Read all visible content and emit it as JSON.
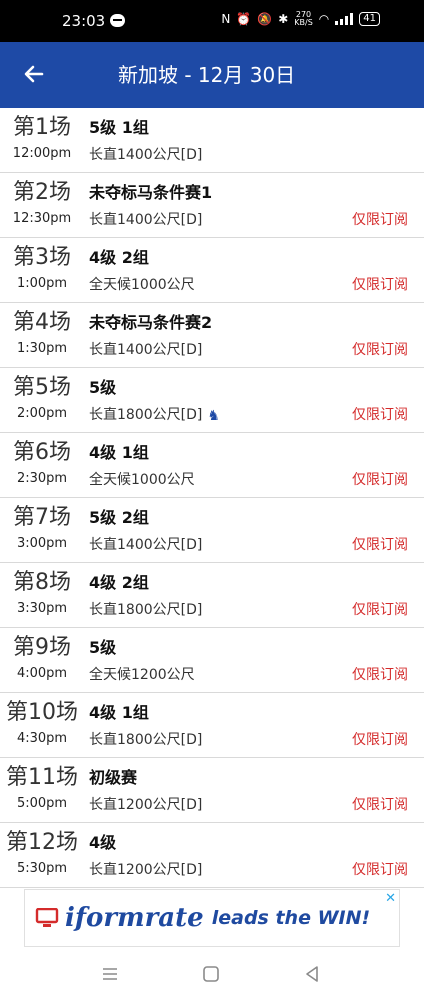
{
  "status_bar": {
    "time": "23:03",
    "speed_value": "270",
    "speed_unit": "KB/S",
    "battery": "41"
  },
  "header": {
    "title": "新加坡 - 12月 30日",
    "back_icon": "arrow-left-icon"
  },
  "races": [
    {
      "number": "第1场",
      "time": "12:00pm",
      "name": "5级 1组",
      "course": "长直1400公尺[D]",
      "subscription": ""
    },
    {
      "number": "第2场",
      "time": "12:30pm",
      "name": "未夺标马条件赛1",
      "course": "长直1400公尺[D]",
      "subscription": "仅限订阅"
    },
    {
      "number": "第3场",
      "time": "1:00pm",
      "name": "4级 2组",
      "course": "全天候1000公尺",
      "subscription": "仅限订阅"
    },
    {
      "number": "第4场",
      "time": "1:30pm",
      "name": "未夺标马条件赛2",
      "course": "长直1400公尺[D]",
      "subscription": "仅限订阅"
    },
    {
      "number": "第5场",
      "time": "2:00pm",
      "name": "5级",
      "course": "长直1800公尺[D]",
      "subscription": "仅限订阅"
    },
    {
      "number": "第6场",
      "time": "2:30pm",
      "name": "4级 1组",
      "course": "全天候1000公尺",
      "subscription": "仅限订阅"
    },
    {
      "number": "第7场",
      "time": "3:00pm",
      "name": "5级 2组",
      "course": "长直1400公尺[D]",
      "subscription": "仅限订阅"
    },
    {
      "number": "第8场",
      "time": "3:30pm",
      "name": "4级 2组",
      "course": "长直1800公尺[D]",
      "subscription": "仅限订阅"
    },
    {
      "number": "第9场",
      "time": "4:00pm",
      "name": "5级",
      "course": "全天候1200公尺",
      "subscription": "仅限订阅"
    },
    {
      "number": "第10场",
      "time": "4:30pm",
      "name": "4级 1组",
      "course": "长直1800公尺[D]",
      "subscription": "仅限订阅"
    },
    {
      "number": "第11场",
      "time": "5:00pm",
      "name": "初级赛",
      "course": "长直1200公尺[D]",
      "subscription": "仅限订阅"
    },
    {
      "number": "第12场",
      "time": "5:30pm",
      "name": "4级",
      "course": "长直1200公尺[D]",
      "subscription": "仅限订阅"
    }
  ],
  "ad": {
    "brand": "iformrate",
    "slogan": "leads the WIN!",
    "brand_color": "#1f4aa0"
  },
  "colors": {
    "appbar": "#1e4aa6",
    "subscription_text": "#d42b2b"
  }
}
